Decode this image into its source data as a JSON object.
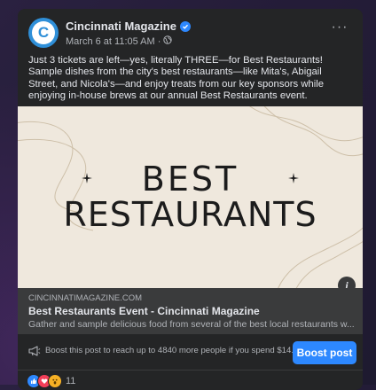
{
  "post": {
    "page_name": "Cincinnati Magazine",
    "avatar_letter": "C",
    "timestamp": "March 6 at 11:05 AM",
    "separator": "·",
    "more_label": "···",
    "text": "Just 3 tickets are left—yes, literally THREE—for Best Restaurants! Sample dishes from the city's best restaurants—like Mita's, Abigail Street, and Nicola's—and enjoy treats from our key sponsors while enjoying in-house brews at our annual Best Restaurants event."
  },
  "hero": {
    "line1": "BEST",
    "line2": "RESTAURANTS",
    "info_label": "i"
  },
  "link": {
    "domain": "CINCINNATIMAGAZINE.COM",
    "title": "Best Restaurants Event - Cincinnati Magazine",
    "description": "Gather and sample delicious food from several of the best local restaurants w..."
  },
  "boost": {
    "text": "Boost this post to reach up to 4840 more people if you spend $14.",
    "button_label": "Boost post"
  },
  "reactions": {
    "count": "11",
    "icons": [
      "like-icon",
      "love-icon",
      "wow-icon"
    ]
  },
  "colors": {
    "card_bg": "#242526",
    "accent": "#2d88ff",
    "hero_bg": "#efe8dd",
    "link_bg": "#3a3b3c"
  }
}
